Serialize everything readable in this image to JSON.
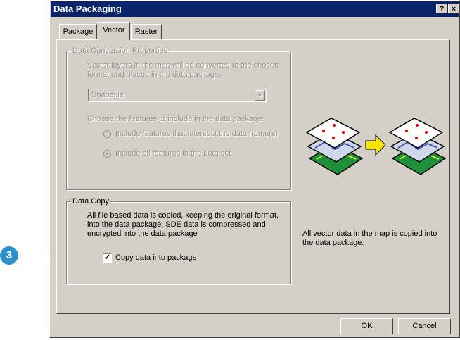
{
  "window": {
    "title": "Data Packaging",
    "help_label": "?",
    "close_label": "×"
  },
  "tabs": [
    {
      "label": "Package",
      "active": false
    },
    {
      "label": "Vector",
      "active": true
    },
    {
      "label": "Raster",
      "active": false
    }
  ],
  "conversion_group": {
    "legend": "Data Conversion Properties",
    "description_line1": "Vector layers in the map will be converted to the chosen",
    "description_line2": "format and placed in the data package.",
    "format_value": "Shapefile",
    "features_prompt": "Choose the features to include in the data package:",
    "option_intersect": "Include features that intersect the data frame(s)",
    "option_all": "Include all features in the data set",
    "option_all_selected": true
  },
  "copy_group": {
    "legend": "Data Copy",
    "description_line1": "All file based data is copied, keeping the original format,",
    "description_line2": "into the data package.  SDE data is compressed and",
    "description_line3": "encrypted into the data package",
    "checkbox_label": "Copy data into package",
    "checkbox_checked": true,
    "side_note_line1": "All vector data in the map is copied into",
    "side_note_line2": "the data package."
  },
  "footer": {
    "ok_label": "OK",
    "cancel_label": "Cancel"
  },
  "callout": {
    "number": "3",
    "color": "#2f8fc9"
  },
  "illustration": {
    "icon": "map-layers-conversion-illustration",
    "arrow_color": "#f5e600",
    "layer_colors": [
      "#ffffff",
      "#cfd8e8",
      "#1f8f3a"
    ]
  }
}
